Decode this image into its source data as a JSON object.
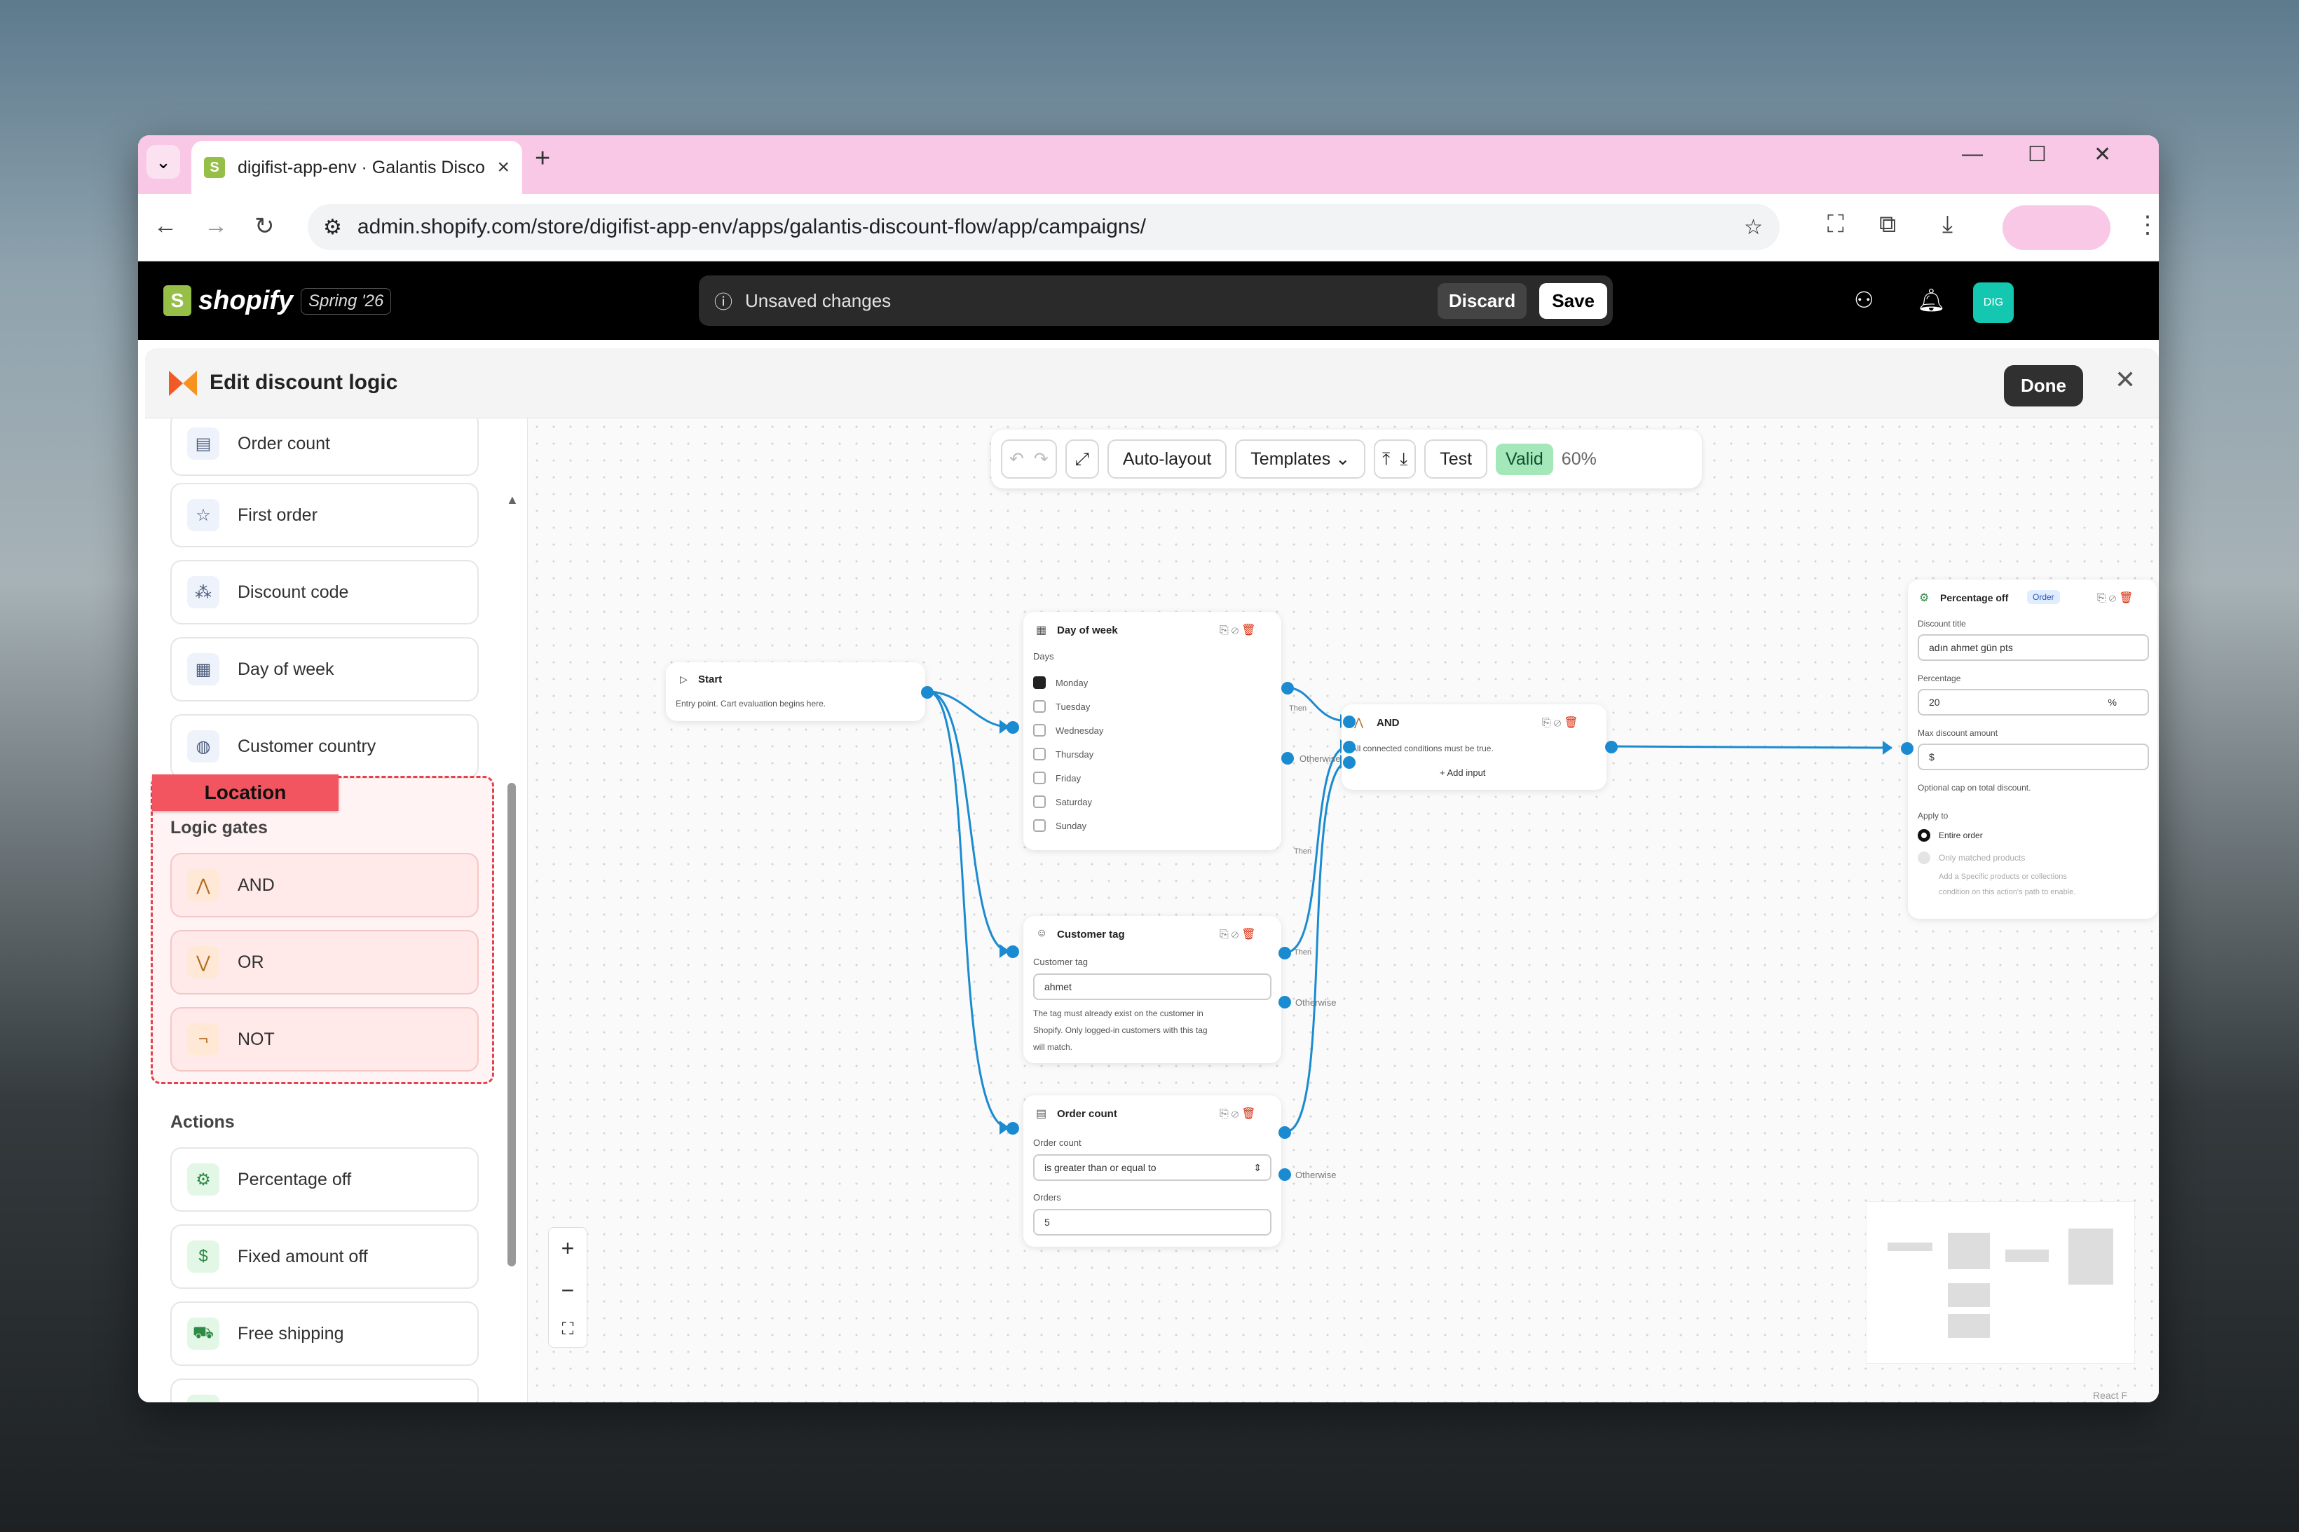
{
  "browser": {
    "tab_title": "digifist-app-env · Galantis Disco",
    "url": "admin.shopify.com/store/digifist-app-env/apps/galantis-discount-flow/app/campaigns/"
  },
  "shopify": {
    "logo": "shopify",
    "edition": "Spring '26",
    "unsaved": "Unsaved changes",
    "discard": "Discard",
    "save": "Save",
    "avatar": "DIG"
  },
  "modal": {
    "title": "Edit discount logic",
    "done": "Done"
  },
  "sidebar": {
    "conditions": [
      "Order count",
      "First order",
      "Discount code",
      "Day of week",
      "Customer country"
    ],
    "location_label": "Location",
    "gates_header": "Logic gates",
    "gates": [
      "AND",
      "OR",
      "NOT"
    ],
    "actions_header": "Actions",
    "actions": [
      "Percentage off",
      "Fixed amount off",
      "Free shipping"
    ]
  },
  "toolbar": {
    "autolayout": "Auto-layout",
    "templates": "Templates",
    "test": "Test",
    "valid": "Valid",
    "zoom": "60%"
  },
  "nodes": {
    "start": {
      "title": "Start",
      "desc": "Entry point. Cart evaluation begins here."
    },
    "dow": {
      "title": "Day of week",
      "label": "Days",
      "days": [
        "Monday",
        "Tuesday",
        "Wednesday",
        "Thursday",
        "Friday",
        "Saturday",
        "Sunday"
      ],
      "checked": "Monday"
    },
    "and": {
      "title": "AND",
      "desc": "All connected conditions must be true.",
      "add": "+ Add input"
    },
    "ctag": {
      "title": "Customer tag",
      "label": "Customer tag",
      "value": "ahmet",
      "help1": "The tag must already exist on the customer in",
      "help2": "Shopify. Only logged-in customers with this tag",
      "help3": "will match."
    },
    "ocount": {
      "title": "Order count",
      "label": "Order count",
      "operator": "is greater than or equal to",
      "orders_label": "Orders",
      "orders": "5"
    },
    "pct": {
      "title": "Percentage off",
      "badge": "Order",
      "title_label": "Discount title",
      "title_value": "adın ahmet gün pts",
      "pct_label": "Percentage",
      "pct_value": "20",
      "pct_unit": "%",
      "max_label": "Max discount amount",
      "max_value": "$",
      "max_help": "Optional cap on total discount.",
      "apply_label": "Apply to",
      "opt1": "Entire order",
      "opt2": "Only matched products",
      "opt2_help1": "Add a Specific products or collections",
      "opt2_help2": "condition on this action's path to enable."
    }
  },
  "edges": {
    "then": "Then",
    "otherwise": "Otherwise"
  },
  "footer": "React F"
}
